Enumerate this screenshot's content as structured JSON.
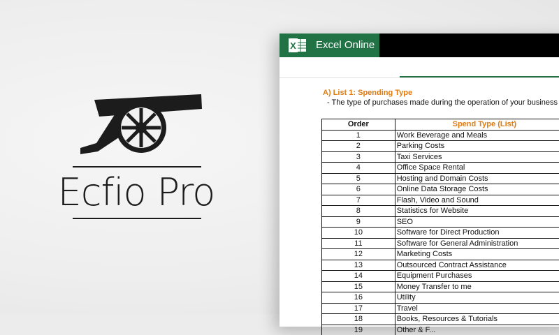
{
  "brand": {
    "logo_text": "Ecfio Pro"
  },
  "app": {
    "name": "Excel Online",
    "icon": "excel-icon",
    "accent_color": "#217346"
  },
  "sheet": {
    "list_title": "A) List 1: Spending Type",
    "list_description": "- The type of purchases made during the operation of your business",
    "headers": {
      "order": "Order",
      "spend_type": "Spend Type (List)"
    },
    "header_accent": "#e07b10",
    "rows": [
      {
        "order": "1",
        "type": "Work Beverage and Meals"
      },
      {
        "order": "2",
        "type": "Parking Costs"
      },
      {
        "order": "3",
        "type": "Taxi Services"
      },
      {
        "order": "4",
        "type": "Office Space Rental"
      },
      {
        "order": "5",
        "type": "Hosting and Domain Costs"
      },
      {
        "order": "6",
        "type": "Online Data Storage Costs"
      },
      {
        "order": "7",
        "type": "Flash, Video and Sound"
      },
      {
        "order": "8",
        "type": "Statistics for Website"
      },
      {
        "order": "9",
        "type": "SEO"
      },
      {
        "order": "10",
        "type": "Software for Direct Production"
      },
      {
        "order": "11",
        "type": "Software for General Administration"
      },
      {
        "order": "12",
        "type": "Marketing Costs"
      },
      {
        "order": "13",
        "type": "Outsourced Contract Assistance"
      },
      {
        "order": "14",
        "type": "Equipment Purchases"
      },
      {
        "order": "15",
        "type": "Money Transfer to me"
      },
      {
        "order": "16",
        "type": "Utility"
      },
      {
        "order": "17",
        "type": "Travel"
      },
      {
        "order": "18",
        "type": "Books, Resources & Tutorials"
      },
      {
        "order": "19",
        "type": "Other & F..."
      }
    ]
  }
}
